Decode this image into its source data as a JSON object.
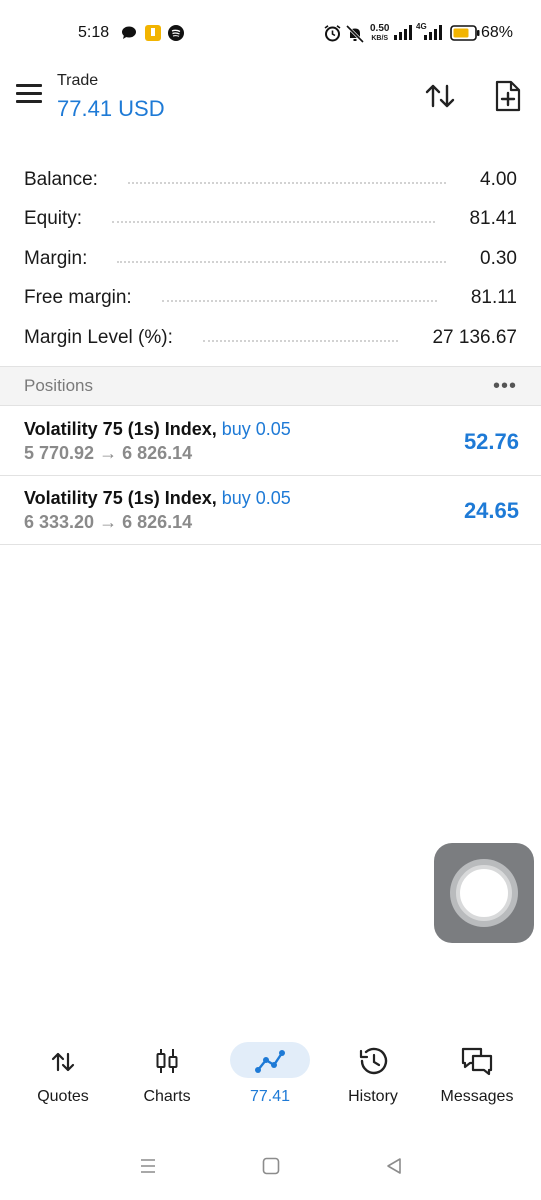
{
  "status_bar": {
    "time": "5:18",
    "net_speed": "0.50",
    "net_unit": "KB/S",
    "network": "4G",
    "battery": "68%",
    "icons": [
      "chat-icon",
      "notes-app-icon",
      "spotify-icon",
      "alarm-icon",
      "mute-icon",
      "signal-icon",
      "battery-icon"
    ]
  },
  "header": {
    "title": "Trade",
    "amount": "77.41 USD",
    "sort_icon": "sort-arrows-icon",
    "new_order_icon": "new-order-icon"
  },
  "summary": [
    {
      "label": "Balance:",
      "value": "4.00"
    },
    {
      "label": "Equity:",
      "value": "81.41"
    },
    {
      "label": "Margin:",
      "value": "0.30"
    },
    {
      "label": "Free margin:",
      "value": "81.11"
    },
    {
      "label": "Margin Level (%):",
      "value": "27 136.67"
    }
  ],
  "positions": {
    "title": "Positions",
    "more": "•••",
    "items": [
      {
        "symbol": "Volatility 75 (1s) Index,",
        "side": "buy 0.05",
        "prices": "5 770.92 → 6 826.14",
        "profit": "52.76"
      },
      {
        "symbol": "Volatility 75 (1s) Index,",
        "side": "buy 0.05",
        "prices": "6 333.20 → 6 826.14",
        "profit": "24.65"
      }
    ]
  },
  "bottom_nav": [
    {
      "label": "Quotes",
      "icon": "quotes-icon",
      "active": false
    },
    {
      "label": "Charts",
      "icon": "charts-icon",
      "active": false
    },
    {
      "label": "77.41",
      "icon": "trade-icon",
      "active": true
    },
    {
      "label": "History",
      "icon": "history-icon",
      "active": false
    },
    {
      "label": "Messages",
      "icon": "messages-icon",
      "active": false
    }
  ],
  "colors": {
    "accent": "#1e7ad6",
    "muted": "#8a8a8a",
    "section_bg": "#f4f4f4"
  }
}
